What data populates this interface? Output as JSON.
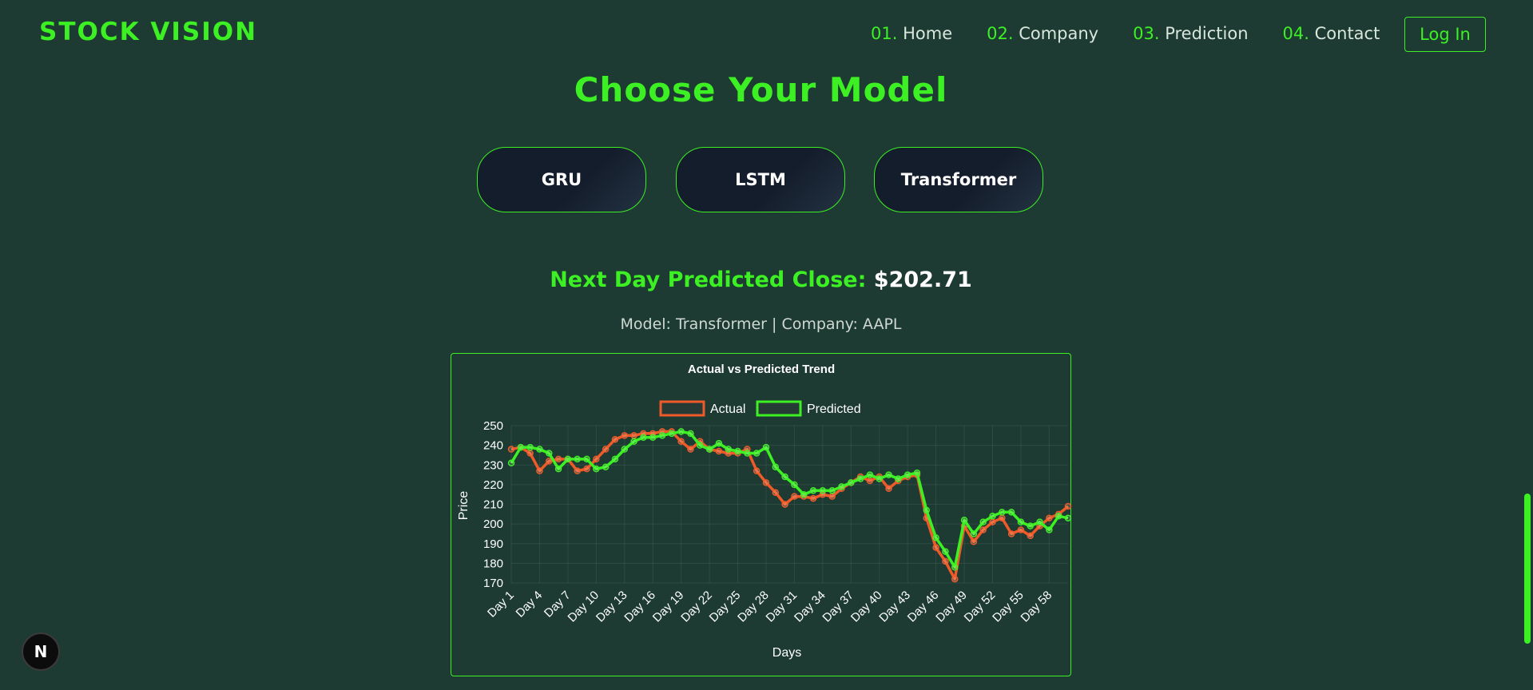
{
  "header": {
    "logo": "STOCK VISION",
    "nav": [
      {
        "num": "01.",
        "label": "Home"
      },
      {
        "num": "02.",
        "label": "Company"
      },
      {
        "num": "03.",
        "label": "Prediction"
      },
      {
        "num": "04.",
        "label": "Contact"
      }
    ],
    "login_label": "Log In"
  },
  "main": {
    "heading": "Choose Your Model",
    "models": [
      "GRU",
      "LSTM",
      "Transformer"
    ],
    "prediction_label": "Next Day Predicted Close:",
    "prediction_value": "$202.71",
    "meta": "Model: Transformer | Company: AAPL"
  },
  "badge": {
    "letter": "N"
  },
  "colors": {
    "accent": "#3cf023",
    "background": "#1d3b33",
    "actual": "#f05a28",
    "predicted": "#3cf023"
  },
  "chart_data": {
    "type": "line",
    "title": "Actual vs Predicted Trend",
    "xlabel": "Days",
    "ylabel": "Price",
    "ylim": [
      170,
      250
    ],
    "yticks": [
      250,
      240,
      230,
      220,
      210,
      200,
      190,
      180,
      170
    ],
    "legend_position": "top-center",
    "grid": true,
    "x": [
      "Day 1",
      "Day 2",
      "Day 3",
      "Day 4",
      "Day 5",
      "Day 6",
      "Day 7",
      "Day 8",
      "Day 9",
      "Day 10",
      "Day 11",
      "Day 12",
      "Day 13",
      "Day 14",
      "Day 15",
      "Day 16",
      "Day 17",
      "Day 18",
      "Day 19",
      "Day 20",
      "Day 21",
      "Day 22",
      "Day 23",
      "Day 24",
      "Day 25",
      "Day 26",
      "Day 27",
      "Day 28",
      "Day 29",
      "Day 30",
      "Day 31",
      "Day 32",
      "Day 33",
      "Day 34",
      "Day 35",
      "Day 36",
      "Day 37",
      "Day 38",
      "Day 39",
      "Day 40",
      "Day 41",
      "Day 42",
      "Day 43",
      "Day 44",
      "Day 45",
      "Day 46",
      "Day 47",
      "Day 48",
      "Day 49",
      "Day 50",
      "Day 51",
      "Day 52",
      "Day 53",
      "Day 54",
      "Day 55",
      "Day 56",
      "Day 57",
      "Day 58",
      "Day 59",
      "Day 60"
    ],
    "xtick_labels": [
      "Day 1",
      "Day 4",
      "Day 7",
      "Day 10",
      "Day 13",
      "Day 16",
      "Day 19",
      "Day 22",
      "Day 25",
      "Day 28",
      "Day 31",
      "Day 34",
      "Day 37",
      "Day 40",
      "Day 43",
      "Day 46",
      "Day 49",
      "Day 52",
      "Day 55",
      "Day 58"
    ],
    "series": [
      {
        "name": "Actual",
        "values": [
          238,
          239,
          236,
          227,
          232,
          233,
          233,
          227,
          228,
          233,
          238,
          243,
          245,
          245,
          246,
          246,
          247,
          247,
          242,
          238,
          242,
          238,
          237,
          236,
          236,
          238,
          227,
          221,
          216,
          210,
          214,
          214,
          213,
          215,
          214,
          218,
          221,
          224,
          222,
          224,
          218,
          222,
          224,
          225,
          203,
          188,
          181,
          172,
          199,
          191,
          197,
          201,
          203,
          195,
          197,
          194,
          199,
          203,
          205,
          209
        ],
        "color": "#f05a28"
      },
      {
        "name": "Predicted",
        "values": [
          231,
          239,
          239,
          238,
          236,
          228,
          233,
          233,
          233,
          228,
          229,
          233,
          238,
          242,
          244,
          244,
          245,
          246,
          247,
          246,
          240,
          238,
          241,
          238,
          237,
          236,
          236,
          239,
          229,
          224,
          220,
          215,
          217,
          217,
          217,
          219,
          221,
          223,
          225,
          223,
          225,
          223,
          225,
          226,
          207,
          193,
          186,
          178,
          202,
          195,
          201,
          204,
          206,
          206,
          201,
          199,
          201,
          197,
          204,
          203
        ],
        "color": "#3cf023"
      }
    ]
  }
}
